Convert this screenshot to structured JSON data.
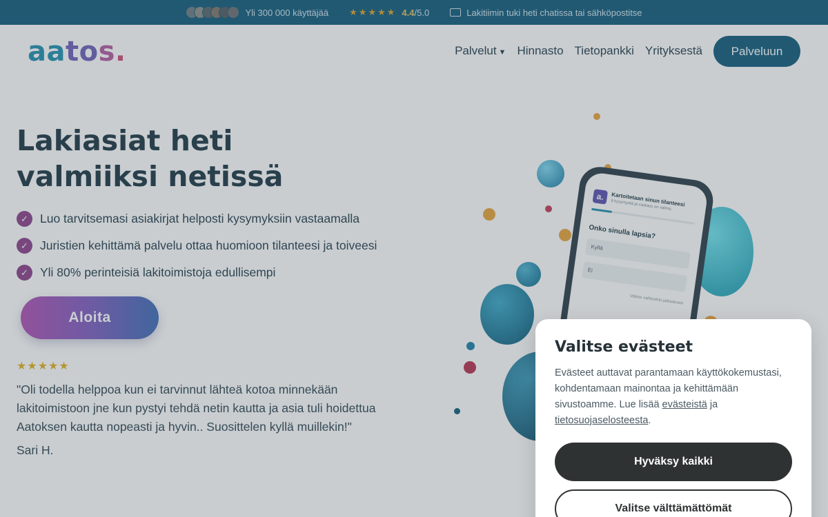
{
  "topbar": {
    "users_text": "Yli 300 000 käyttäjää",
    "stars": "★★★★★",
    "rating_value": "4.4",
    "rating_scale": "/5.0",
    "support_text": "Lakitiimin tuki heti chatissa tai sähköpostitse"
  },
  "header": {
    "logo": {
      "a1": "aa",
      "a2": "to",
      "a3": "s",
      "a4": "."
    },
    "nav": [
      "Palvelut",
      "Hinnasto",
      "Tietopankki",
      "Yrityksestä"
    ],
    "cta": "Palveluun"
  },
  "hero": {
    "title": "Lakiasiat heti valmiiksi netissä",
    "benefits": [
      "Luo tarvitsemasi asiakirjat helposti kysymyksiin vastaamalla",
      "Juristien kehittämä palvelu ottaa huomioon tilanteesi ja toiveesi",
      "Yli 80% perinteisiä lakitoimistoja edullisempi"
    ],
    "start_button": "Aloita",
    "review_stars": "★★★★★",
    "review_text": "\"Oli todella helppoa kun ei tarvinnut lähteä kotoa minnekään lakitoimistoon jne kun pystyi tehdä netin kautta ja asia tuli hoidettua Aatoksen kautta nopeasti ja hyvin.. Suosittelen kyllä muillekin!\"",
    "reviewer": "Sari H."
  },
  "phone": {
    "logo": "a.",
    "app_title": "Kartoitetaan sinun tilanteesi",
    "app_sub": "9 kysymystä ja vastaus on valmis",
    "question": "Onko sinulla lapsia?",
    "option_yes": "Kyllä",
    "option_no": "Ei",
    "hint": "Valitse vaihtoehto jatkaaksesi",
    "progress": 0.2
  },
  "cookie": {
    "title": "Valitse evästeet",
    "text_1": "Evästeet auttavat parantamaan käyttökokemustasi, kohdentamaan mainontaa ja kehittämään sivustoamme. Lue lisää ",
    "link_cookies": "evästeistä",
    "text_2": " ja ",
    "link_privacy": "tietosuojaselosteesta",
    "text_3": ".",
    "accept_all": "Hyväksy kaikki",
    "necessary_only": "Valitse välttämättömät"
  },
  "colors": {
    "topbar": "#0f5a7a",
    "accent_purple": "#8b3f8a",
    "dark_button": "#2f3233"
  }
}
